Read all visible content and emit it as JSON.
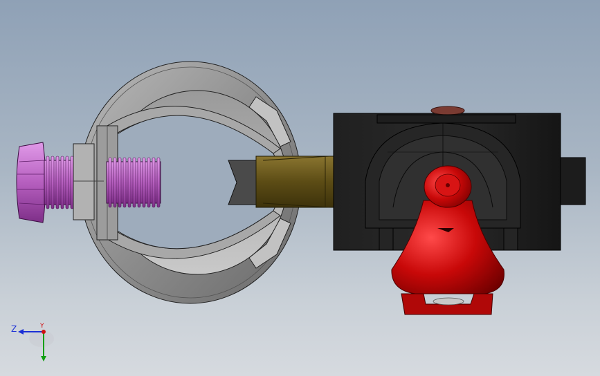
{
  "viewport": {
    "background_top": "#8fa1b6",
    "background_bottom": "#d6dadf"
  },
  "model": {
    "parts": [
      {
        "name": "ring-clamp",
        "color": "#8a8a8a"
      },
      {
        "name": "thumb-screw",
        "color": "#b65fbf"
      },
      {
        "name": "brass-sleeve",
        "color": "#6b5a1c"
      },
      {
        "name": "black-housing",
        "color": "#1a1a1a"
      },
      {
        "name": "red-cone-knob",
        "color": "#c40a0a"
      }
    ]
  },
  "triad": {
    "z_label": "Z",
    "y_label": "Y",
    "z_color": "#1a2fd6",
    "y_color": "#10a010",
    "x_color": "#d01010"
  }
}
